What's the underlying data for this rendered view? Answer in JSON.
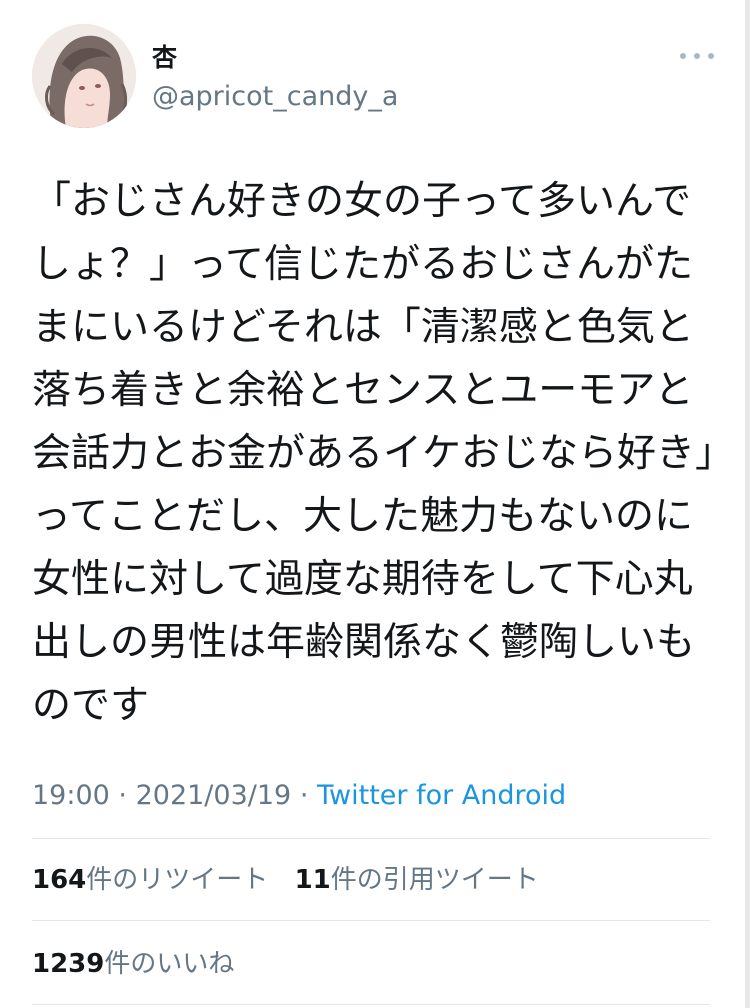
{
  "tweet": {
    "author": {
      "display_name": "杏",
      "handle": "@apricot_candy_a"
    },
    "text": "「おじさん好きの女の子って多いんでしょ？」って信じたがるおじさんがたまにいるけどそれは「清潔感と色気と落ち着きと余裕とセンスとユーモアと会話力とお金があるイケおじなら好き」ってことだし、大した魅力もないのに女性に対して過度な期待をして下心丸出しの男性は年齢関係なく鬱陶しいものです",
    "time": "19:00",
    "date": "2021/03/19",
    "separator": "·",
    "source": "Twitter for Android",
    "retweets": {
      "count": "164",
      "label": "件のリツイート"
    },
    "quotes": {
      "count": "11",
      "label": "件の引用ツイート"
    },
    "likes": {
      "count": "1239",
      "label": "件のいいね"
    }
  },
  "icons": {
    "more": "more-horizontal-icon",
    "avatar": "avatar-illustration"
  },
  "colors": {
    "text": "#14171a",
    "secondary": "#657786",
    "link": "#1b95e0",
    "divider": "#e1e8ed",
    "icon": "#aab8c2"
  }
}
